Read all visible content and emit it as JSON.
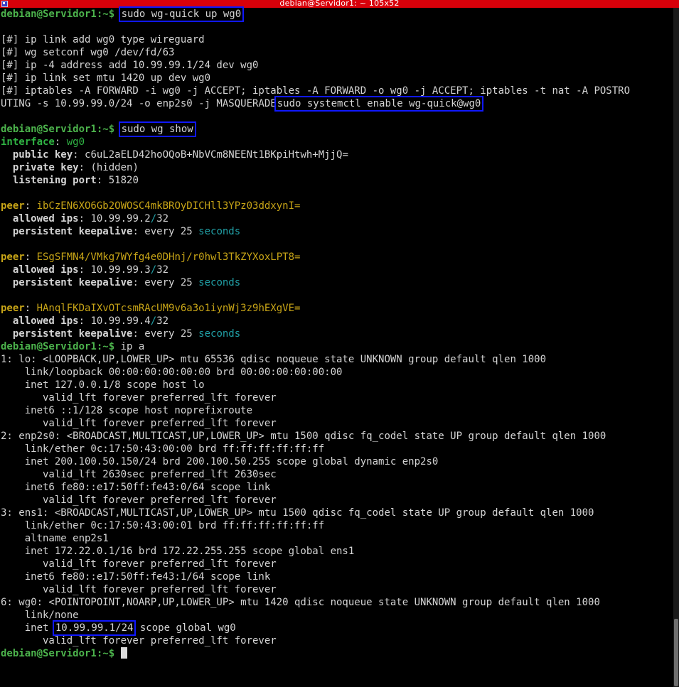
{
  "window": {
    "title": "debian@Servidor1: ~ 105x52"
  },
  "prompt": "debian@Servidor1:~$ ",
  "cmd1": "sudo wg-quick up wg0",
  "wgquick_out": [
    "[#] ip link add wg0 type wireguard",
    "[#] wg setconf wg0 /dev/fd/63",
    "[#] ip -4 address add 10.99.99.1/24 dev wg0",
    "[#] ip link set mtu 1420 up dev wg0",
    "[#] iptables -A FORWARD -i wg0 -j ACCEPT; iptables -A FORWARD -o wg0 -j ACCEPT; iptables -t nat -A POSTRO",
    "UTING -s 10.99.99.0/24 -o enp2s0 -j MASQUERADE"
  ],
  "cmd2": "sudo systemctl enable wg-quick@wg0",
  "cmd3": "sudo wg show",
  "wg": {
    "interface_label": "interface",
    "interface_name": "wg0",
    "public_key_label": "public key",
    "public_key": "c6uL2aELD42hoOQoB+NbVCm8NEENt1BKpiHtwh+MjjQ=",
    "private_key_label": "private key",
    "private_key": "(hidden)",
    "listen_port_label": "listening port",
    "listen_port": "51820",
    "peer_label": "peer",
    "allowed_ips_label": "allowed ips",
    "keepalive_label": "persistent keepalive",
    "keepalive_value": "every 25 ",
    "seconds": "seconds",
    "peers": [
      {
        "key": "ibCzEN6XO6Gb2OWOSC4mkBROyDICHll3YPz03ddxynI=",
        "ip": "10.99.99.2",
        "mask": "32"
      },
      {
        "key": "ESgSFMN4/VMkg7WYfg4e0DHnj/r0hwl3TkZYXoxLPT8=",
        "ip": "10.99.99.3",
        "mask": "32"
      },
      {
        "key": "HAnqlFKDaIXvOTcsmRAcUM9v6a3o1iynWj3z9hEXgVE=",
        "ip": "10.99.99.4",
        "mask": "32"
      }
    ]
  },
  "cmd4": "ip a",
  "ipa_out": [
    "1: lo: <LOOPBACK,UP,LOWER_UP> mtu 65536 qdisc noqueue state UNKNOWN group default qlen 1000",
    "    link/loopback 00:00:00:00:00:00 brd 00:00:00:00:00:00",
    "    inet 127.0.0.1/8 scope host lo",
    "       valid_lft forever preferred_lft forever",
    "    inet6 ::1/128 scope host noprefixroute",
    "       valid_lft forever preferred_lft forever",
    "2: enp2s0: <BROADCAST,MULTICAST,UP,LOWER_UP> mtu 1500 qdisc fq_codel state UP group default qlen 1000",
    "    link/ether 0c:17:50:43:00:00 brd ff:ff:ff:ff:ff:ff",
    "    inet 200.100.50.150/24 brd 200.100.50.255 scope global dynamic enp2s0",
    "       valid_lft 2630sec preferred_lft 2630sec",
    "    inet6 fe80::e17:50ff:fe43:0/64 scope link",
    "       valid_lft forever preferred_lft forever",
    "3: ens1: <BROADCAST,MULTICAST,UP,LOWER_UP> mtu 1500 qdisc fq_codel state UP group default qlen 1000",
    "    link/ether 0c:17:50:43:00:01 brd ff:ff:ff:ff:ff:ff",
    "    altname enp2s1",
    "    inet 172.22.0.1/16 brd 172.22.255.255 scope global ens1",
    "       valid_lft forever preferred_lft forever",
    "    inet6 fe80::e17:50ff:fe43:1/64 scope link",
    "       valid_lft forever preferred_lft forever",
    "6: wg0: <POINTOPOINT,NOARP,UP,LOWER_UP> mtu 1420 qdisc noqueue state UNKNOWN group default qlen 1000",
    "    link/none"
  ],
  "wg0_inet_prefix": "    inet ",
  "wg0_inet_addr": "10.99.99.1/24",
  "wg0_inet_suffix": " scope global wg0",
  "wg0_valid": "       valid_lft forever preferred_lft forever"
}
